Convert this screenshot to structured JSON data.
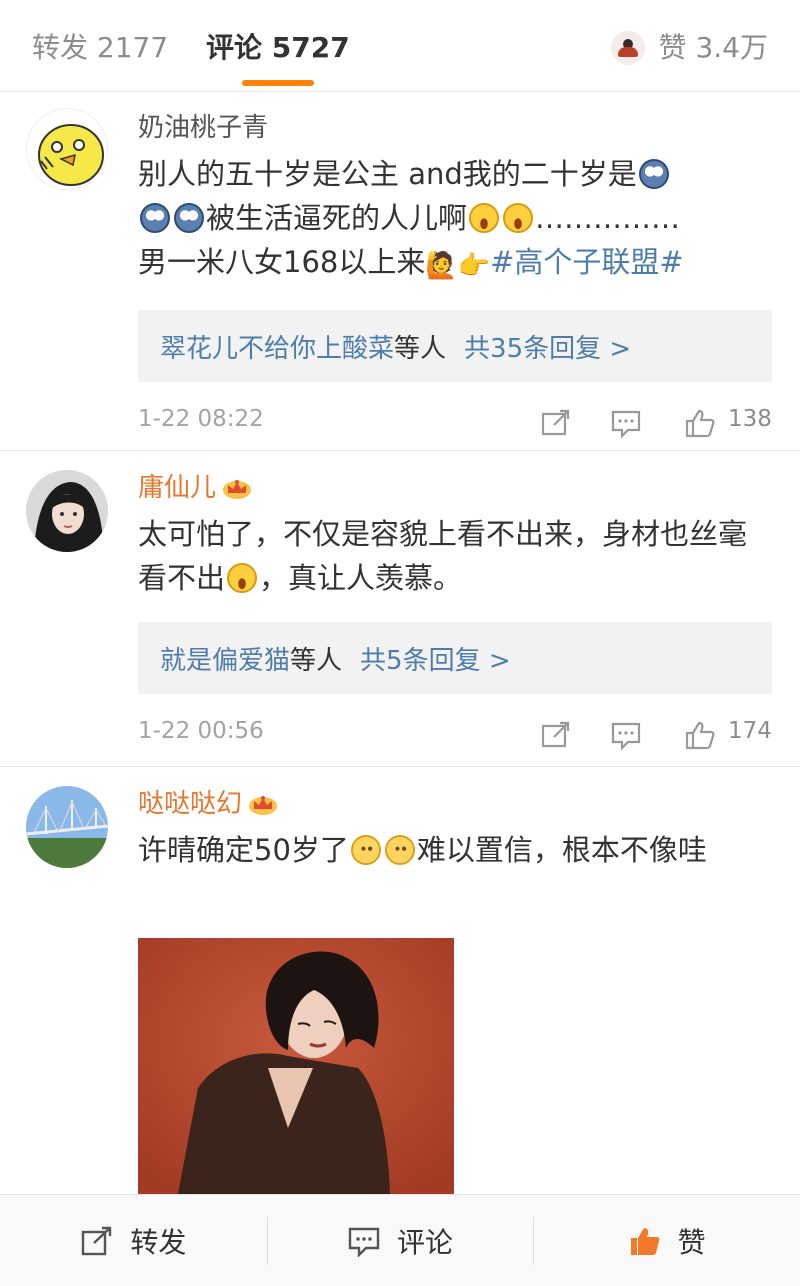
{
  "tabs": {
    "repost": "转发 2177",
    "comment": "评论 5727",
    "like": "赞 3.4万"
  },
  "comments": [
    {
      "name": "奶油桃子青",
      "text_a": "别人的五十岁是公主 and我的二十岁是",
      "text_b": "被生活逼死的人儿啊",
      "text_c": "……………",
      "text_d": "男一米八女168以上来",
      "topic": "#高个子联盟#",
      "reply_names": "翠花儿不给你上酸菜",
      "reply_mid": "等人",
      "reply_count": "共35条回复 >",
      "time": "1-22 08:22",
      "likes": "138"
    },
    {
      "name": "庸仙儿",
      "text_a": "太可怕了，不仅是容貌上看不出来，身材也丝毫看不出",
      "text_b": "，真让人羡慕。",
      "reply_names": "就是偏爱猫",
      "reply_mid": "等人",
      "reply_count": "共5条回复 >",
      "time": "1-22 00:56",
      "likes": "174"
    },
    {
      "name": "哒哒哒幻",
      "text_a": "许晴确定50岁了",
      "text_b": "难以置信，根本不像哇"
    }
  ],
  "bottom_bar": {
    "repost": "转发",
    "comment": "评论",
    "like": "赞"
  },
  "colors": {
    "accent": "#ff8200",
    "link": "#4f7dab",
    "vip_name": "#e8762e",
    "like_active": "#f07a2a"
  },
  "icons": [
    "repost-icon",
    "comment-icon",
    "like-icon",
    "crown-icon",
    "emoji-shock-icon",
    "emoji-cry-icon",
    "emoji-think-icon"
  ]
}
